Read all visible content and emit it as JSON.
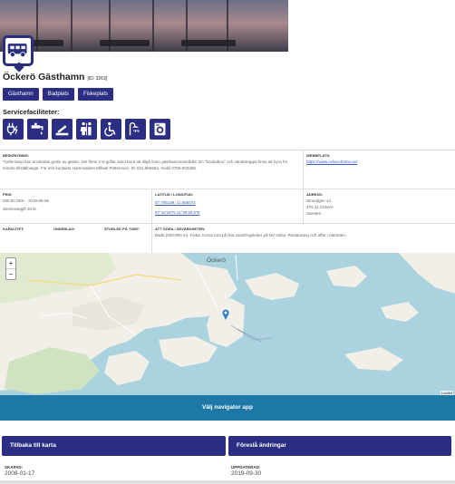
{
  "place": {
    "name": "Öckerö Gästhamn",
    "id": "[ID: 3263]"
  },
  "categories": [
    "Gästhamn",
    "Badplats",
    "Fiskeplats"
  ],
  "facilities": {
    "heading": "Servicefaciliteter:",
    "icons": [
      "electricity-icon",
      "water-icon",
      "septic-emptying-icon",
      "toilets-icon",
      "wheelchair-icon",
      "shower-icon",
      "laundry-icon"
    ]
  },
  "info": {
    "description_label": "BESKRIVNING:",
    "description": "Trailerramp kan användas gratis av gäster. Det finns 2 st grillar samt bord att tillgå inom gästhamnsområdet. En \"bookaboo\" och vändetrappa finns att hyra för mindre tillställningar. För info kontakta Hamnvakten Mikael Pettersson, tfn 031-966684, mobil 0706-903298.",
    "website_label": "WEBBPLATS:",
    "website": "https://www.ockerohamn.se/",
    "price_label": "PRIS:",
    "price": "200.00 SEK - 2019-06-05",
    "service_price": "Serviceavgift 30 kr.",
    "coords_label": "LATITUD / LONGITUD:",
    "coords_decimal": "57.705139, 11.658472",
    "coords_dms": "57°42'18\"N 11°39'30.5\"E",
    "address_label": "ADRESS:",
    "address_lines": [
      "Strandgen 14",
      "475 31 Öckerö",
      "Sweden"
    ],
    "capacity_label": "KAPACITET:",
    "substrate_label": "UNDERLAG:",
    "size_label": "STORLEK PÅ TOMT:",
    "todo_label": "ATT GÖRA / SEVÄRDHETER:",
    "todo": "Bada (500-800 m). Fiska. Korsa runt på fina vandringsleder på NV sidan. Restaurang och affär i närheten."
  },
  "map": {
    "zoom_in": "+",
    "zoom_out": "−",
    "place_labels": [
      "Öckerö",
      "Leaflet"
    ],
    "water_color": "#aad3df",
    "land_color": "#f2efe9",
    "marker_color": "#2c7ec4"
  },
  "nav_button": "Välj navigator app",
  "back_button": "Tillbaka till karta",
  "suggest_button": "Föreslå ändringar",
  "created_label": "SKAPAD:",
  "created": "2008-01-17",
  "updated_label": "UPPDATERAD:",
  "updated": "2019-09-30"
}
